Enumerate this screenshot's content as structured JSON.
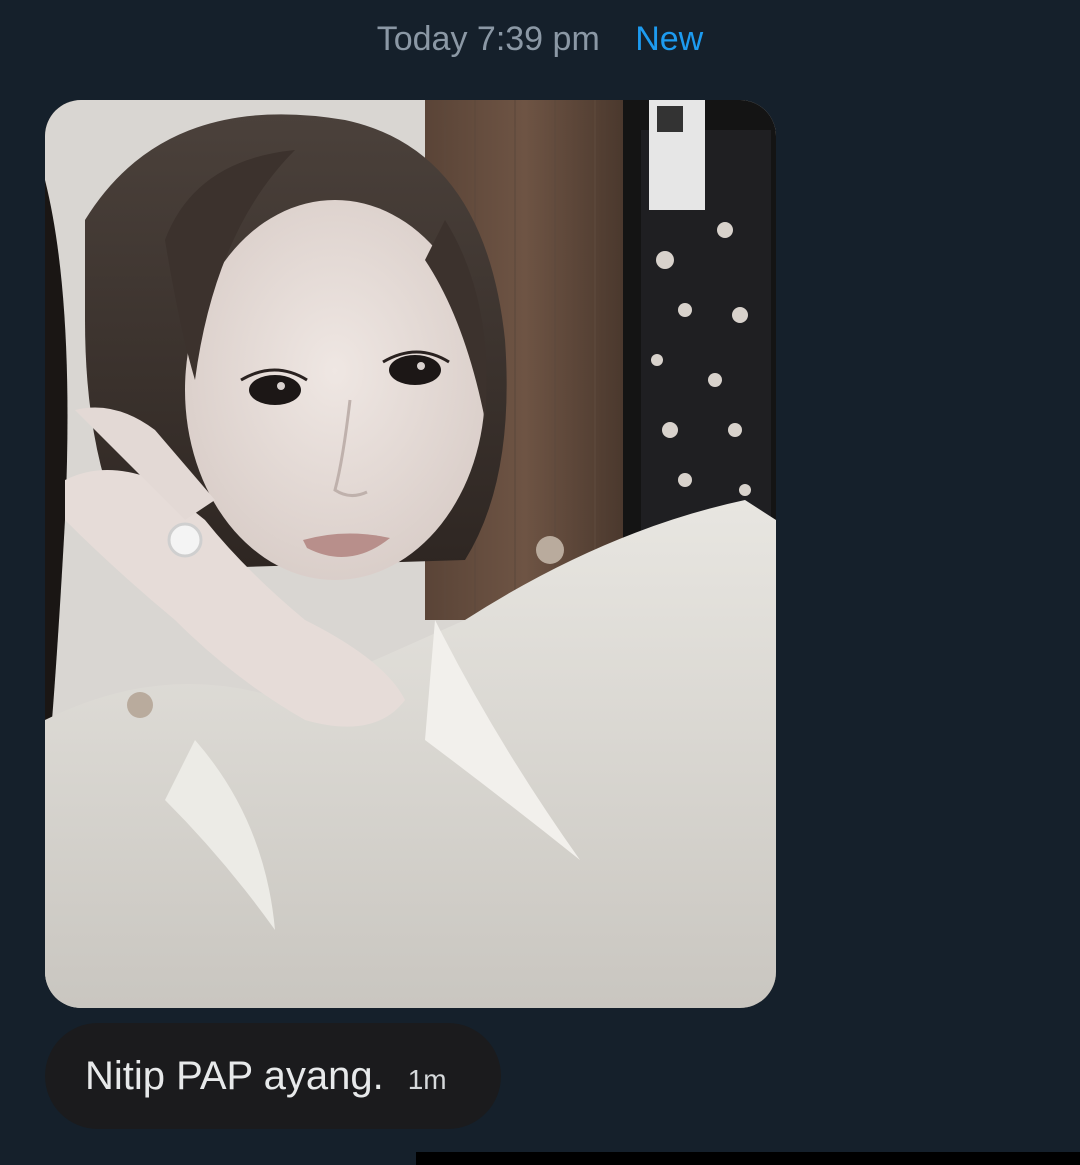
{
  "header": {
    "date_label": "Today 7:39 pm",
    "new_label": "New"
  },
  "message": {
    "photo_icon": "selfie-photo",
    "text": "Nitip PAP ayang.",
    "time": "1m"
  },
  "colors": {
    "background": "#15202b",
    "date_text": "#8b98a5",
    "new_accent": "#1d9bf0",
    "bubble": "#1b1b1d",
    "message_text": "#e7e9ea"
  }
}
